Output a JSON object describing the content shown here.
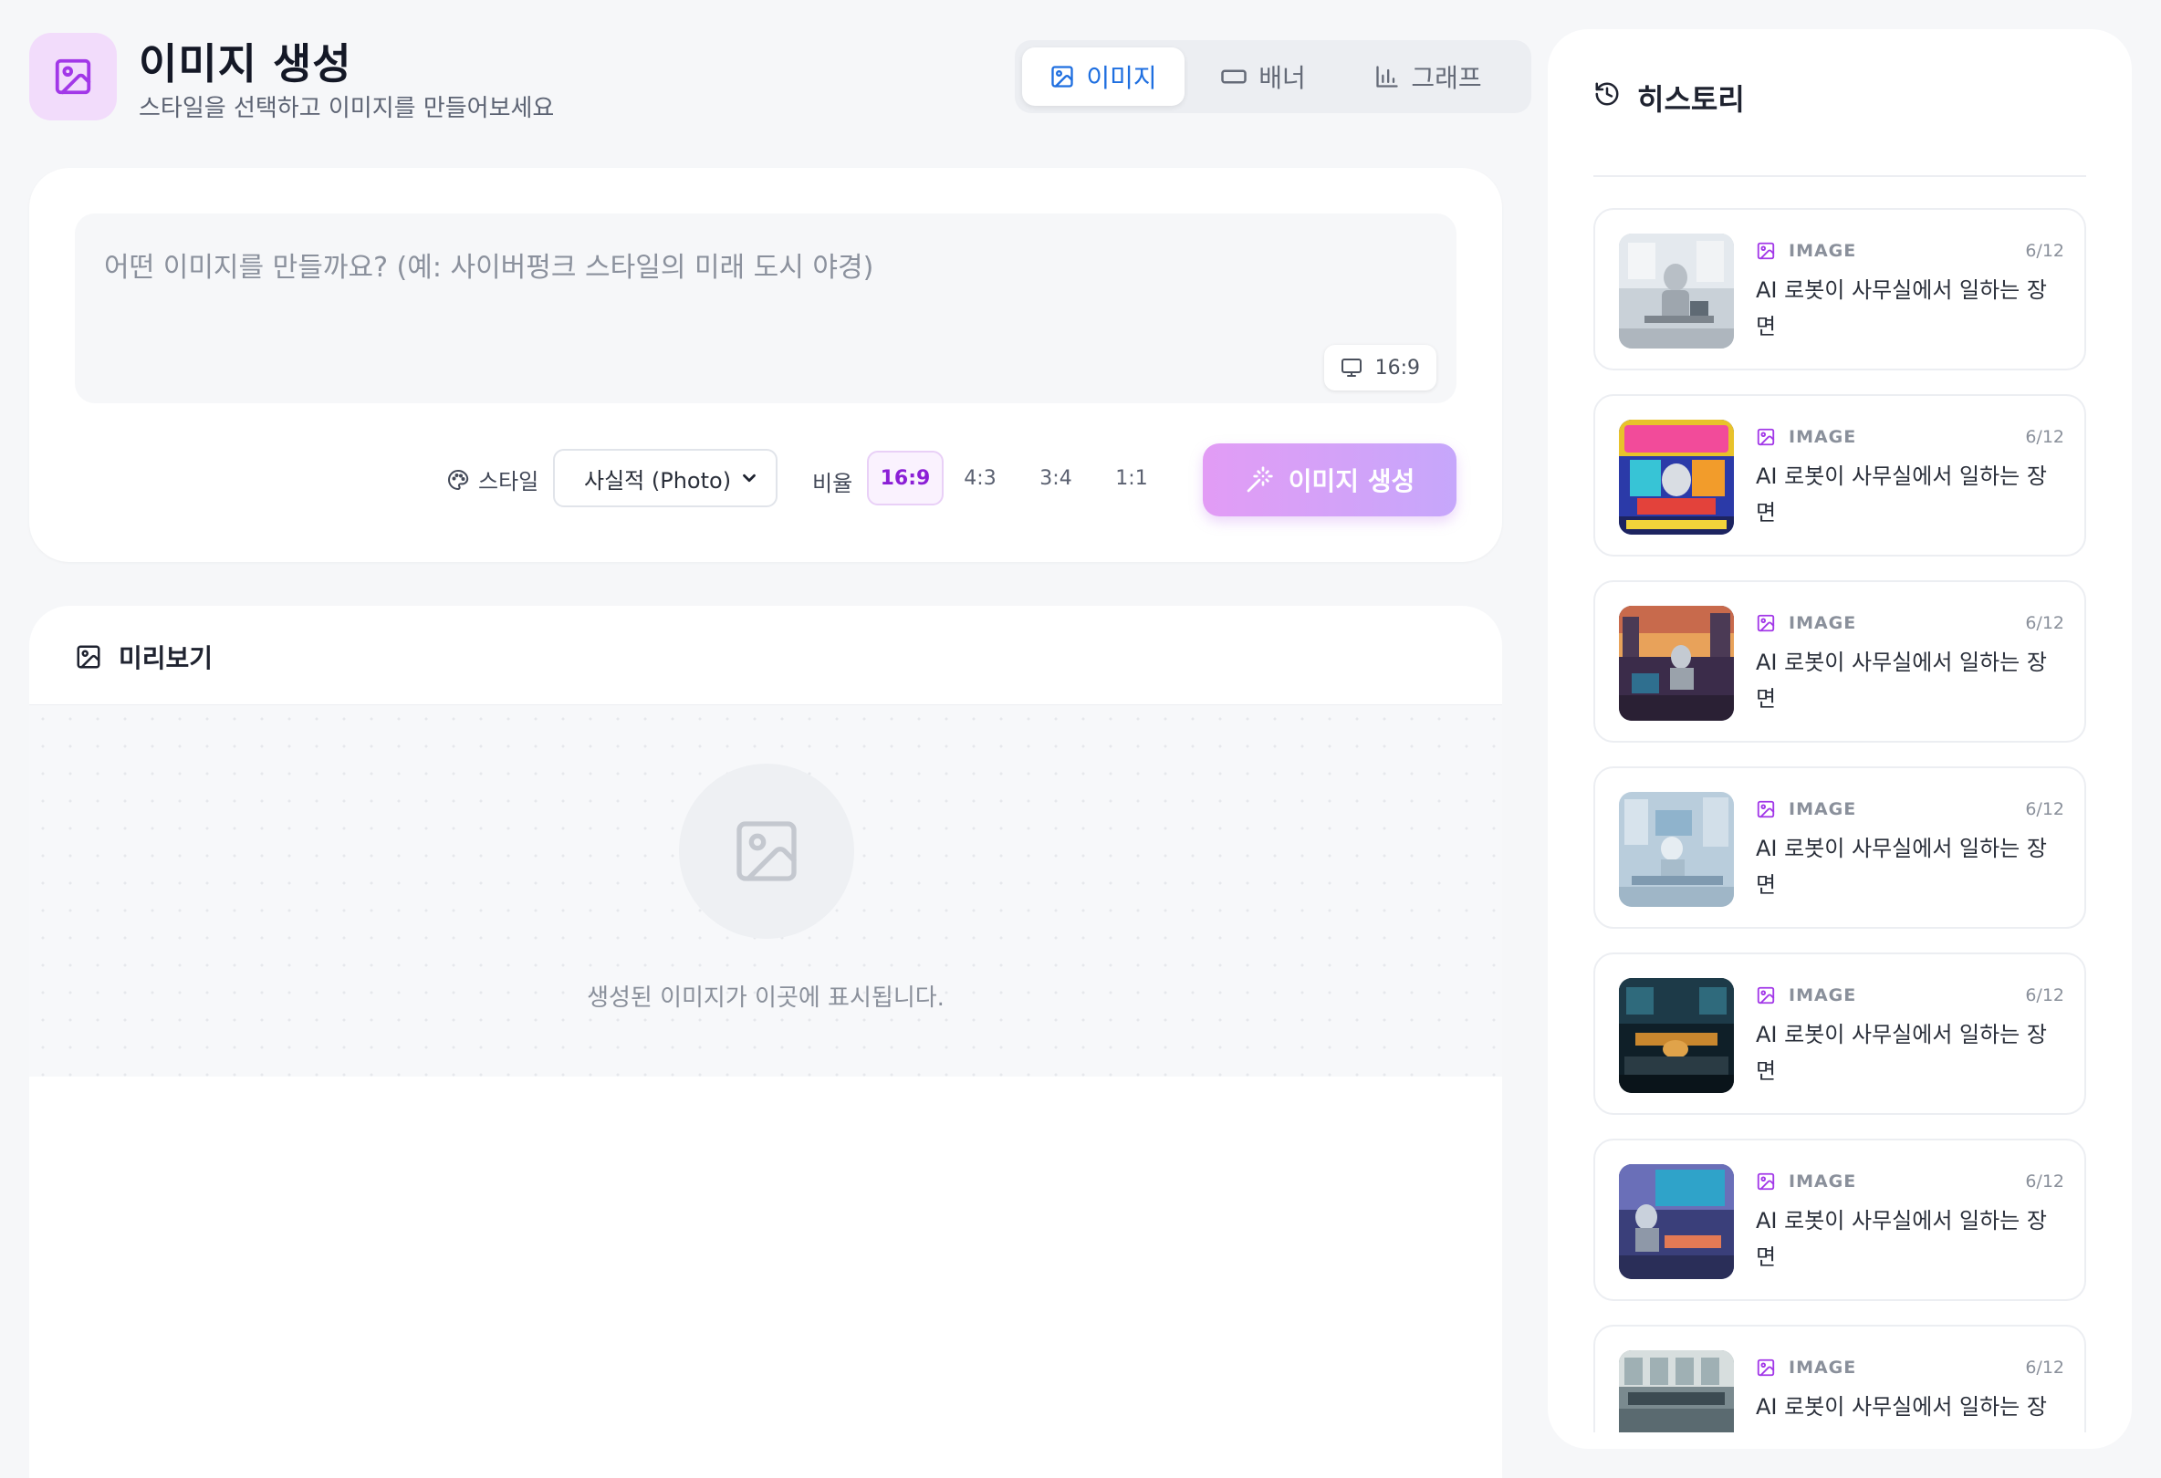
{
  "header": {
    "title": "이미지 생성",
    "subtitle": "스타일을 선택하고 이미지를 만들어보세요",
    "app_icon": "image-icon"
  },
  "mode_tabs": [
    {
      "label": "이미지",
      "icon": "image-icon",
      "active": true
    },
    {
      "label": "배너",
      "icon": "rectangle-icon",
      "active": false
    },
    {
      "label": "그래프",
      "icon": "bar-chart-icon",
      "active": false
    }
  ],
  "prompt": {
    "placeholder": "어떤 이미지를 만들까요? (예: 사이버펑크 스타일의 미래 도시 야경)",
    "value": "",
    "ratio_chip": "16:9"
  },
  "controls": {
    "style_label": "스타일",
    "style_selected": "사실적 (Photo)",
    "ratio_label": "비율",
    "ratios": [
      "16:9",
      "4:3",
      "3:4",
      "1:1"
    ],
    "selected_ratio": "16:9",
    "generate_label": "이미지 생성"
  },
  "preview": {
    "title": "미리보기",
    "empty_text": "생성된 이미지가 이곳에 표시됩니다."
  },
  "history": {
    "title": "히스토리",
    "items": [
      {
        "type": "IMAGE",
        "date": "6/12",
        "title": "AI 로봇이 사무실에서 일하는 장면"
      },
      {
        "type": "IMAGE",
        "date": "6/12",
        "title": "AI 로봇이 사무실에서 일하는 장면"
      },
      {
        "type": "IMAGE",
        "date": "6/12",
        "title": "AI 로봇이 사무실에서 일하는 장면"
      },
      {
        "type": "IMAGE",
        "date": "6/12",
        "title": "AI 로봇이 사무실에서 일하는 장면"
      },
      {
        "type": "IMAGE",
        "date": "6/12",
        "title": "AI 로봇이 사무실에서 일하는 장면"
      },
      {
        "type": "IMAGE",
        "date": "6/12",
        "title": "AI 로봇이 사무실에서 일하는 장면"
      },
      {
        "type": "IMAGE",
        "date": "6/12",
        "title": "AI 로봇이 사무실에서 일하는 장면"
      }
    ]
  },
  "colors": {
    "accent_purple": "#a238e8",
    "active_tab_blue": "#1f6fe0",
    "button_gradient_start": "#e29cf5",
    "button_gradient_end": "#c6a7fb"
  }
}
